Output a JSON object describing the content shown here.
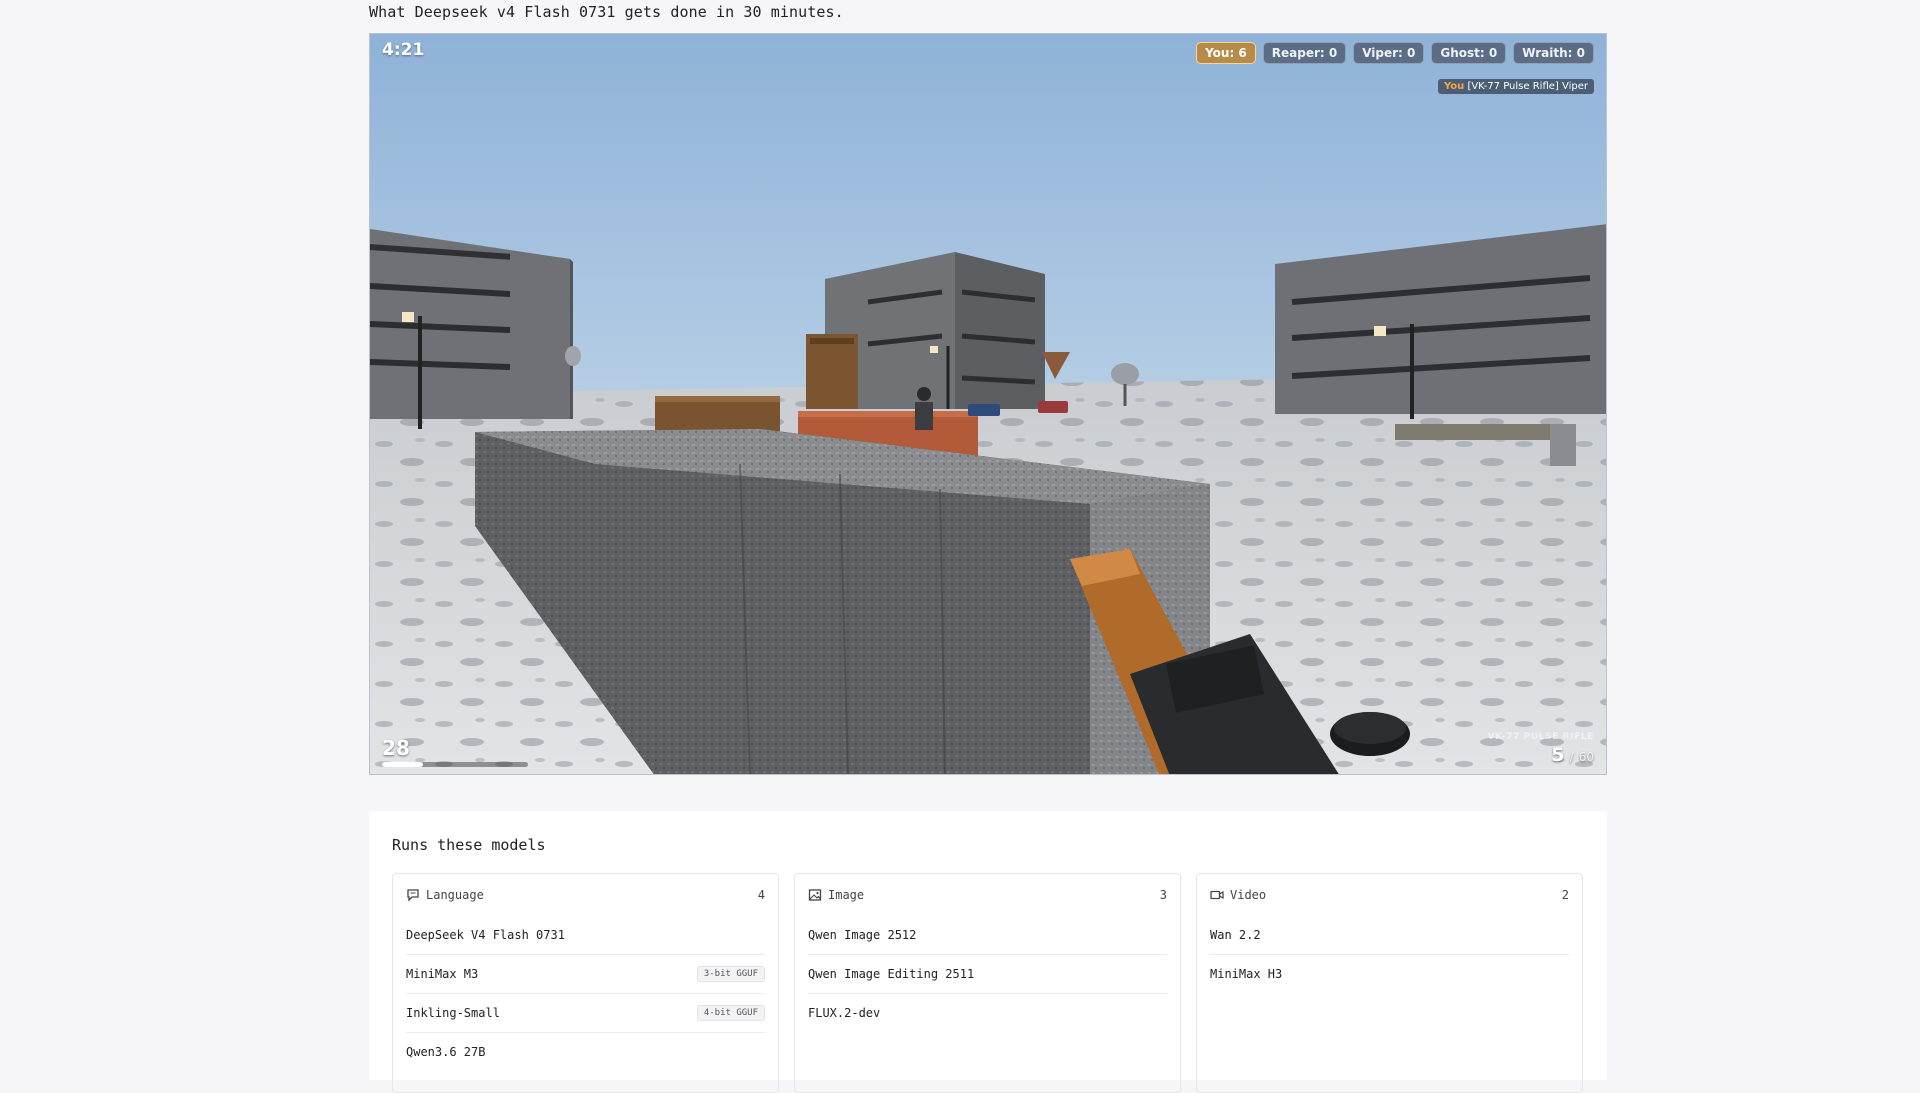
{
  "caption": "What Deepseek v4 Flash 0731 gets done in 30 minutes.",
  "game": {
    "timer": "4:21",
    "scoreboard": [
      {
        "label": "You: 6",
        "is_player": true
      },
      {
        "label": "Reaper: 0",
        "is_player": false
      },
      {
        "label": "Viper: 0",
        "is_player": false
      },
      {
        "label": "Ghost: 0",
        "is_player": false
      },
      {
        "label": "Wraith: 0",
        "is_player": false
      }
    ],
    "killfeed": {
      "killer": "You",
      "weapon": "[VK-77 Pulse Rifle]",
      "victim": "Viper"
    },
    "health": "28",
    "health_fraction": 0.28,
    "weapon_name": "VK-77 PULSE RIFLE",
    "ammo_current": "5",
    "ammo_separator": "/",
    "ammo_reserve": "60"
  },
  "models": {
    "title": "Runs these models",
    "categories": [
      {
        "name": "Language",
        "icon": "chat-icon",
        "count": "4",
        "items": [
          {
            "name": "DeepSeek V4 Flash 0731",
            "tag": ""
          },
          {
            "name": "MiniMax M3",
            "tag": "3-bit GGUF"
          },
          {
            "name": "Inkling-Small",
            "tag": "4-bit GGUF"
          },
          {
            "name": "Qwen3.6 27B",
            "tag": ""
          }
        ]
      },
      {
        "name": "Image",
        "icon": "image-icon",
        "count": "3",
        "items": [
          {
            "name": "Qwen Image 2512",
            "tag": ""
          },
          {
            "name": "Qwen Image Editing 2511",
            "tag": ""
          },
          {
            "name": "FLUX.2-dev",
            "tag": ""
          }
        ]
      },
      {
        "name": "Video",
        "icon": "video-icon",
        "count": "2",
        "items": [
          {
            "name": "Wan 2.2",
            "tag": ""
          },
          {
            "name": "MiniMax H3",
            "tag": ""
          }
        ]
      }
    ]
  }
}
